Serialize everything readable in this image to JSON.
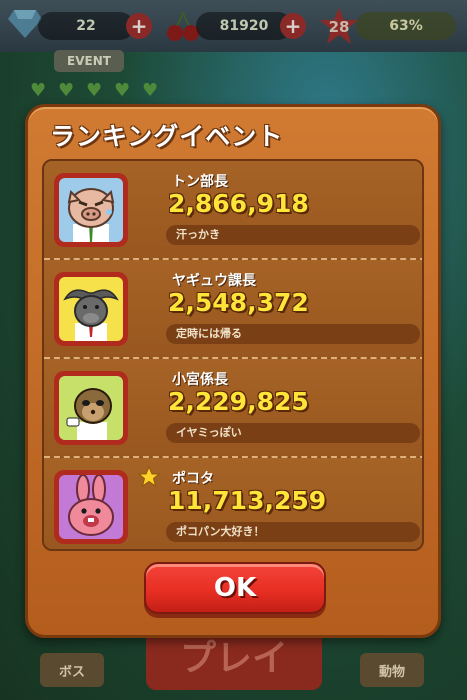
{
  "hud": {
    "gems": "22",
    "cherries": "81920",
    "level": "28",
    "progress": "63%",
    "progress_value": 0.63,
    "event_label": "EVENT",
    "plus_label": "+"
  },
  "background": {
    "play_label": "プレイ",
    "boss_label": "ボス",
    "animals_label": "動物"
  },
  "dialog": {
    "title": "ランキングイベント",
    "ok_label": "OK",
    "entries": [
      {
        "name": "トン部長",
        "score": "2,866,918",
        "comment": "汗っかき",
        "portrait_icon": "pig-boss-portrait",
        "portrait_bg": "#9ecbea",
        "is_player": false
      },
      {
        "name": "ヤギュウ課長",
        "score": "2,548,372",
        "comment": "定時には帰る",
        "portrait_icon": "buffalo-manager-portrait",
        "portrait_bg": "#f6e14a",
        "is_player": false
      },
      {
        "name": "小宮係長",
        "score": "2,229,825",
        "comment": "イヤミっぽい",
        "portrait_icon": "meerkat-chief-portrait",
        "portrait_bg": "#c7e06a",
        "is_player": false
      },
      {
        "name": "ポコタ",
        "score": "11,713,259",
        "comment": "ポコパン大好き！",
        "portrait_icon": "rabbit-pokota-portrait",
        "portrait_bg": "#c27ad6",
        "is_player": true
      }
    ]
  },
  "colors": {
    "dialog_wood": "#c46a28",
    "score_yellow": "#ffe53a",
    "ok_red": "#e82f24"
  }
}
